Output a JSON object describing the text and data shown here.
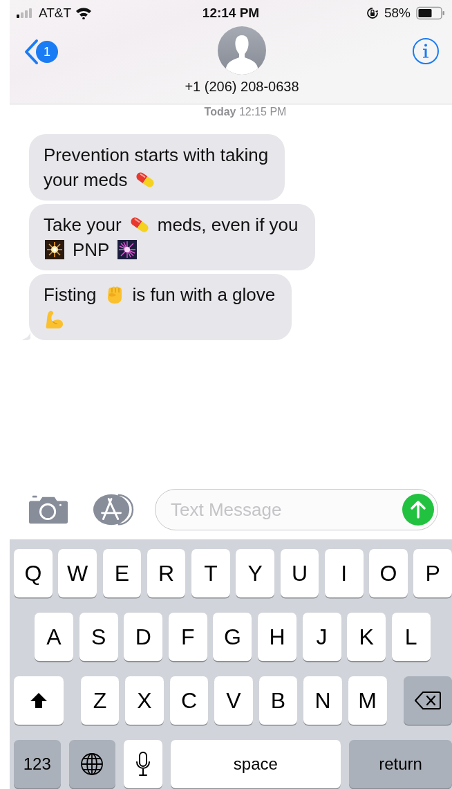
{
  "status_bar": {
    "carrier": "AT&T",
    "time": "12:14 PM",
    "battery": "58%"
  },
  "nav_bar": {
    "unread_badge": "1",
    "contact": "+1 (206) 208-0638"
  },
  "timestamp": {
    "day": "Today",
    "time": "12:15 PM"
  },
  "messages": [
    {
      "lines": [
        [
          {
            "kind": "text",
            "text": "Prevention starts with taking"
          }
        ],
        [
          {
            "kind": "text",
            "text": "your meds"
          },
          {
            "kind": "pill"
          }
        ]
      ],
      "tail": false
    },
    {
      "lines": [
        [
          {
            "kind": "text",
            "text": "Take your"
          },
          {
            "kind": "pill"
          },
          {
            "kind": "text",
            "text": "meds, even if you"
          }
        ],
        [
          {
            "kind": "sparkler"
          },
          {
            "kind": "text",
            "text": "PNP"
          },
          {
            "kind": "fireworks"
          }
        ]
      ],
      "tail": false
    },
    {
      "lines": [
        [
          {
            "kind": "text",
            "text": "Fisting"
          },
          {
            "kind": "fist"
          },
          {
            "kind": "text",
            "text": "is fun with a glove"
          }
        ],
        [
          {
            "kind": "biceps"
          }
        ]
      ],
      "tail": true
    }
  ],
  "compose": {
    "placeholder": "Text Message"
  },
  "keyboard": [
    [
      {
        "kind": "letter",
        "label": "Q"
      },
      {
        "kind": "letter",
        "label": "W"
      },
      {
        "kind": "letter",
        "label": "E"
      },
      {
        "kind": "letter",
        "label": "R"
      },
      {
        "kind": "letter",
        "label": "T"
      },
      {
        "kind": "letter",
        "label": "Y"
      },
      {
        "kind": "letter",
        "label": "U"
      },
      {
        "kind": "letter",
        "label": "I"
      },
      {
        "kind": "letter",
        "label": "O"
      },
      {
        "kind": "letter",
        "label": "P"
      }
    ],
    [
      {
        "kind": "letter",
        "label": "A"
      },
      {
        "kind": "letter",
        "label": "S"
      },
      {
        "kind": "letter",
        "label": "D"
      },
      {
        "kind": "letter",
        "label": "F"
      },
      {
        "kind": "letter",
        "label": "G"
      },
      {
        "kind": "letter",
        "label": "H"
      },
      {
        "kind": "letter",
        "label": "J"
      },
      {
        "kind": "letter",
        "label": "K"
      },
      {
        "kind": "letter",
        "label": "L"
      }
    ],
    [
      {
        "kind": "shift"
      },
      {
        "kind": "letter",
        "label": "Z"
      },
      {
        "kind": "letter",
        "label": "X"
      },
      {
        "kind": "letter",
        "label": "C"
      },
      {
        "kind": "letter",
        "label": "V"
      },
      {
        "kind": "letter",
        "label": "B"
      },
      {
        "kind": "letter",
        "label": "N"
      },
      {
        "kind": "letter",
        "label": "M"
      },
      {
        "kind": "backspace"
      }
    ],
    [
      {
        "kind": "function",
        "label": "123"
      },
      {
        "kind": "globe"
      },
      {
        "kind": "mic"
      },
      {
        "kind": "space",
        "label": "space"
      },
      {
        "kind": "function",
        "label": "return"
      }
    ]
  ]
}
